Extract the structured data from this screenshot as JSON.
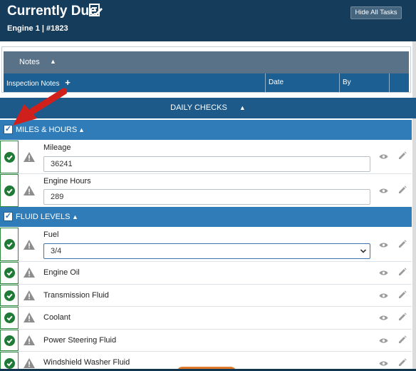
{
  "header": {
    "title": "Currently Due",
    "subtitle": "Engine 1 | #1823",
    "hide_button": "Hide All Tasks",
    "title_icon": "checklist-edit-icon"
  },
  "notes": {
    "label": "Notes",
    "columns": [
      "Inspection Notes",
      "Date",
      "By",
      ""
    ]
  },
  "daily_checks": {
    "label": "DAILY CHECKS"
  },
  "sections": [
    {
      "label": "MILES & HOURS",
      "checked": true,
      "items": [
        {
          "label": "Mileage",
          "value": "36241",
          "status": "ok"
        },
        {
          "label": "Engine Hours",
          "value": "289",
          "status": "ok"
        }
      ]
    },
    {
      "label": "FLUID LEVELS",
      "checked": true,
      "items": [
        {
          "label": "Fuel",
          "value": "3/4",
          "status": "ok"
        },
        {
          "label": "Engine Oil",
          "status": "ok"
        },
        {
          "label": "Transmission Fluid",
          "status": "ok"
        },
        {
          "label": "Coolant",
          "status": "ok"
        },
        {
          "label": "Power Steering Fluid",
          "status": "ok"
        },
        {
          "label": "Windshield Washer Fluid",
          "status": "ok"
        }
      ]
    }
  ],
  "colors": {
    "header": "#163c5c",
    "section": "#2f7cb8",
    "ok_green": "#1f7a35",
    "annotation_arrow": "#d0201c"
  }
}
